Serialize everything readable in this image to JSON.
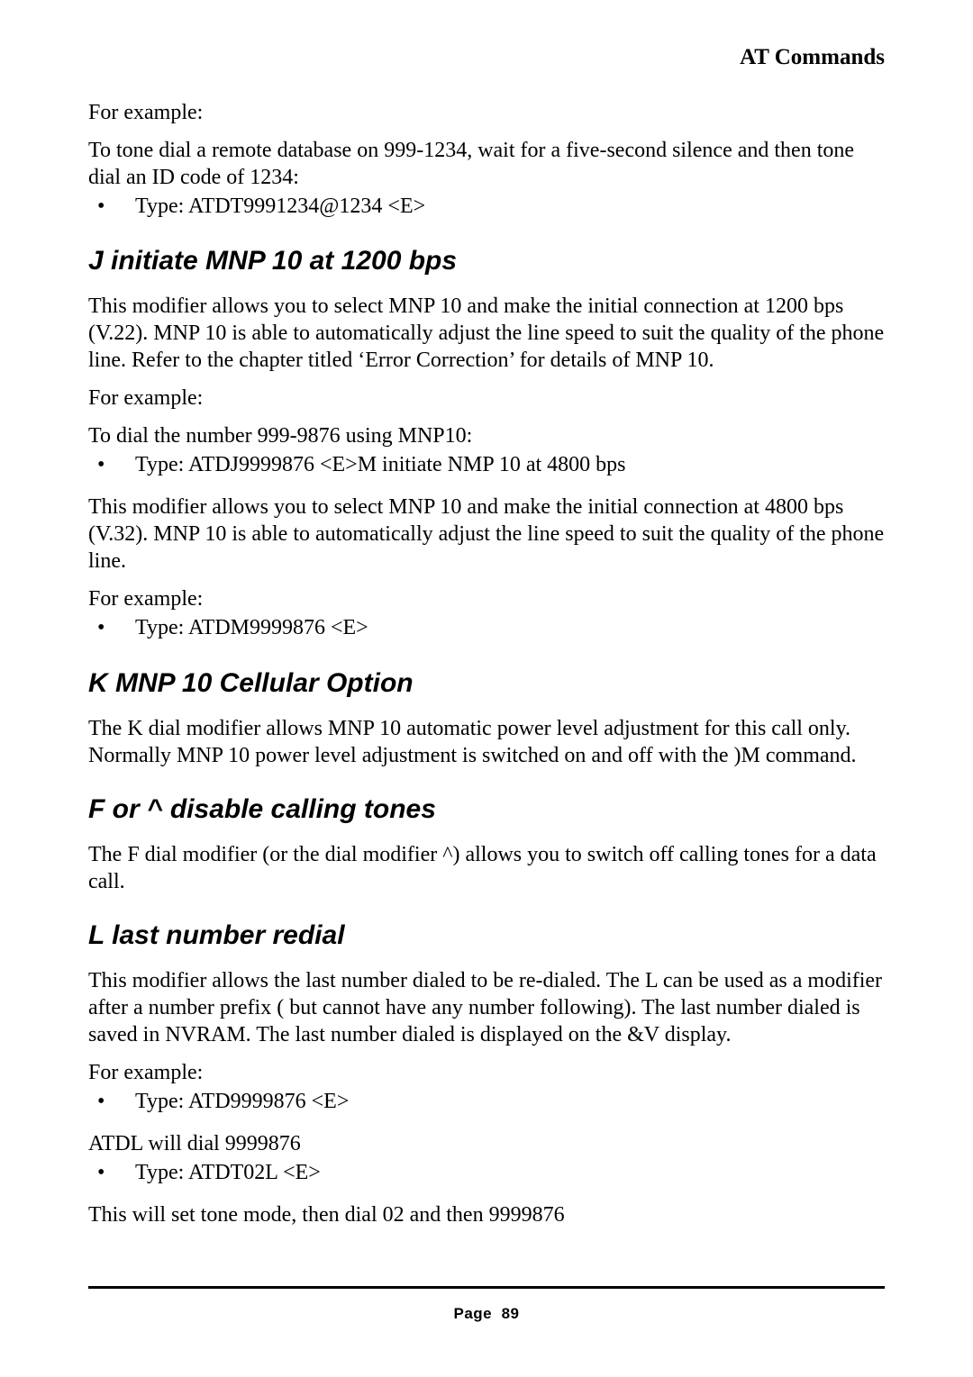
{
  "header": {
    "title": "AT Commands"
  },
  "s0": {
    "p1": "For example:",
    "p2": "To tone dial a remote database on 999-1234, wait for a five-second silence and then tone dial an ID code of 1234:",
    "b1": "Type: ATDT9991234@1234 <E>"
  },
  "s1": {
    "heading": "J initiate MNP 10 at 1200 bps",
    "p1": "This modifier allows you to select MNP 10 and make the initial connection at 1200 bps (V.22). MNP 10 is able to automatically adjust the line speed to suit the quality of the phone line. Refer to the chapter titled ‘Error Correction’ for details of MNP 10.",
    "p2": "For example:",
    "p3": "To dial the number 999-9876 using MNP10:",
    "b1": "Type: ATDJ9999876 <E>M initiate NMP 10 at 4800 bps",
    "p4": "This modifier allows you to select MNP 10 and make the initial connection at 4800 bps (V.32). MNP 10 is able to automatically adjust the line speed to suit the quality of the phone line.",
    "p5": "For example:",
    "b2": "Type: ATDM9999876 <E>"
  },
  "s2": {
    "heading": "K MNP 10 Cellular Option",
    "p1": "The K dial modifier allows MNP 10 automatic power level adjustment for this call only. Normally MNP 10 power level adjustment is switched on and off with the )M command."
  },
  "s3": {
    "heading": "F or ^ disable calling tones",
    "p1": "The F dial modifier (or the dial modifier ^) allows you to switch off calling tones for a data call."
  },
  "s4": {
    "heading": "L last number redial",
    "p1": "This modifier allows the last number dialed to be re-dialed. The L can be used as a modifier after a number prefix ( but cannot have any number following). The last number dialed is saved in NVRAM. The last number dialed is displayed on the &V display.",
    "p2": "For example:",
    "b1": "Type: ATD9999876 <E>",
    "p3": "ATDL will dial 9999876",
    "b2": "Type: ATDT02L <E>",
    "p4": "This will set tone mode, then dial 02 and then 9999876"
  },
  "footer": {
    "label": "Page",
    "number": "89"
  }
}
